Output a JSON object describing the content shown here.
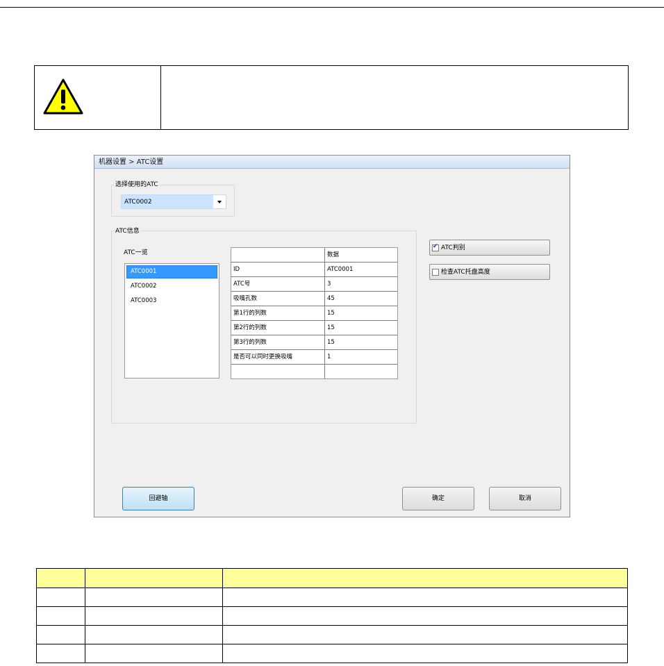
{
  "dialog": {
    "title": "机器设置 > ATC设置",
    "select_group_label": "选择使用的ATC",
    "selected_atc": "ATC0002",
    "info_group_label": "ATC信息",
    "list_label": "ATC一览",
    "atc_list": [
      "ATC0001",
      "ATC0002",
      "ATC0003"
    ],
    "selected_list_index": 0,
    "grid_header": "数据",
    "grid_rows": [
      {
        "label": "ID",
        "value": "ATC0001"
      },
      {
        "label": "ATC号",
        "value": "3"
      },
      {
        "label": "吸嘴孔数",
        "value": "45"
      },
      {
        "label": "第1行的列数",
        "value": "15"
      },
      {
        "label": "第2行的列数",
        "value": "15"
      },
      {
        "label": "第3行的列数",
        "value": "15"
      },
      {
        "label": "是否可以同时更换吸嘴",
        "value": "1"
      },
      {
        "label": "",
        "value": ""
      }
    ],
    "checks": [
      {
        "label": "ATC判别",
        "checked": true
      },
      {
        "label": "检查ATC托盘高度",
        "checked": false
      }
    ],
    "buttons": {
      "return_axis": "回避轴",
      "ok": "确定",
      "cancel": "取消"
    }
  },
  "warning_icon": "warning-triangle-icon",
  "colors": {
    "warning_fill": "#ffff00",
    "table_header": "#ffff99",
    "selection": "#3399ff"
  }
}
